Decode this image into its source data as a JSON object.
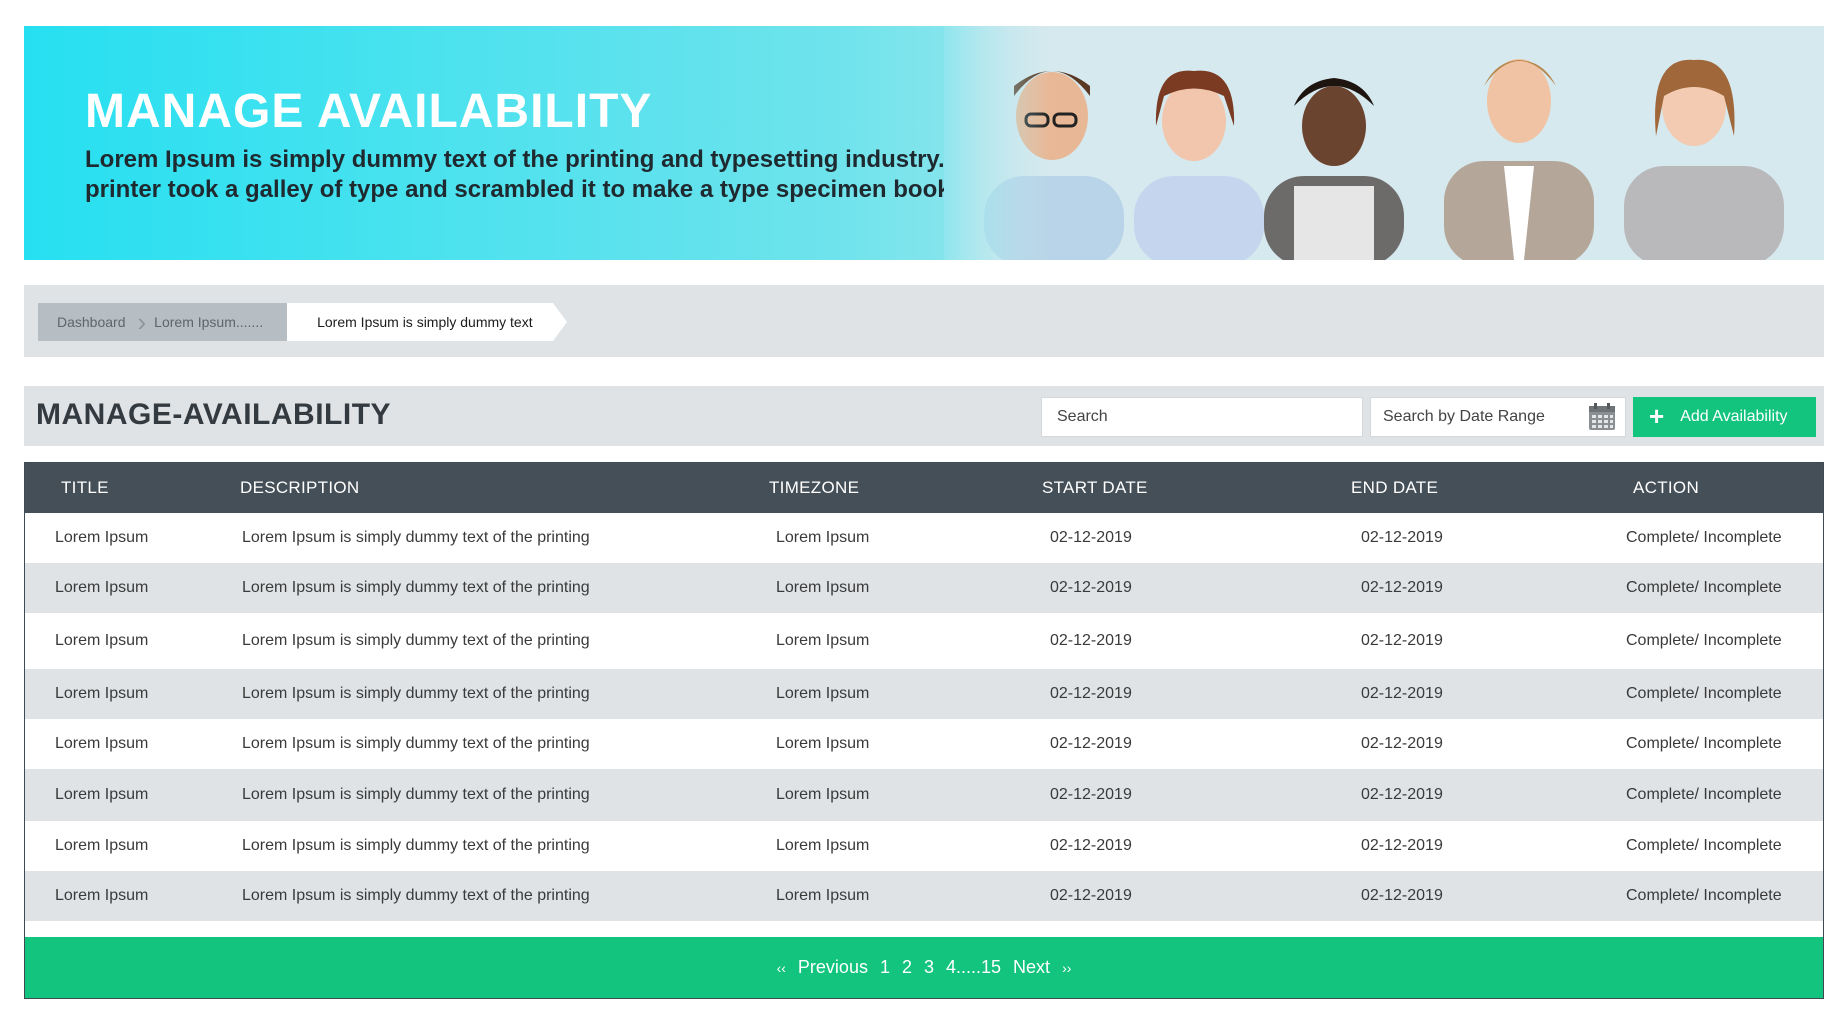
{
  "banner": {
    "title": "MANAGE AVAILABILITY",
    "subtitle_line1": "Lorem Ipsum is simply dummy text of the printing and typesetting industry.",
    "subtitle_line2": "printer took a galley of type and scrambled it to make a type specimen book."
  },
  "breadcrumb": {
    "items": [
      "Dashboard",
      "Lorem Ipsum.......",
      "Lorem Ipsum is simply dummy text"
    ]
  },
  "section": {
    "title": "MANAGE-AVAILABILITY",
    "search_placeholder": "Search",
    "date_placeholder": "Search by Date Range",
    "add_label": "Add Availability",
    "calendar_icon": "calendar-icon"
  },
  "table": {
    "headers": [
      "TITLE",
      "DESCRIPTION",
      "TIMEZONE",
      "START DATE",
      "END DATE",
      "ACTION"
    ],
    "rows": [
      [
        "Lorem Ipsum",
        "Lorem Ipsum is simply dummy text of the printing",
        "Lorem Ipsum",
        "02-12-2019",
        "02-12-2019",
        "Complete/ Incomplete"
      ],
      [
        "Lorem Ipsum",
        "Lorem Ipsum is simply dummy text of the printing",
        "Lorem Ipsum",
        "02-12-2019",
        "02-12-2019",
        "Complete/ Incomplete"
      ],
      [
        "Lorem Ipsum",
        "Lorem Ipsum is simply dummy text of the printing",
        "Lorem Ipsum",
        "02-12-2019",
        "02-12-2019",
        "Complete/ Incomplete"
      ],
      [
        "Lorem Ipsum",
        "Lorem Ipsum is simply dummy text of the printing",
        "Lorem Ipsum",
        "02-12-2019",
        "02-12-2019",
        "Complete/ Incomplete"
      ],
      [
        "Lorem Ipsum",
        "Lorem Ipsum is simply dummy text of the printing",
        "Lorem Ipsum",
        "02-12-2019",
        "02-12-2019",
        "Complete/ Incomplete"
      ],
      [
        "Lorem Ipsum",
        "Lorem Ipsum is simply dummy text of the printing",
        "Lorem Ipsum",
        "02-12-2019",
        "02-12-2019",
        "Complete/ Incomplete"
      ],
      [
        "Lorem Ipsum",
        "Lorem Ipsum is simply dummy text of the printing",
        "Lorem Ipsum",
        "02-12-2019",
        "02-12-2019",
        "Complete/ Incomplete"
      ],
      [
        "Lorem Ipsum",
        "Lorem Ipsum is simply dummy text of the printing",
        "Lorem Ipsum",
        "02-12-2019",
        "02-12-2019",
        "Complete/ Incomplete"
      ]
    ]
  },
  "pagination": {
    "first": "‹‹",
    "previous": "Previous",
    "pages": [
      "1",
      "2",
      "3",
      "4.....15"
    ],
    "next": "Next",
    "last": "››"
  },
  "colors": {
    "accent_green": "#12c47e",
    "header_dark": "#454f57",
    "banner_cyan": "#26e0f1",
    "row_alt": "#dfe3e6"
  }
}
